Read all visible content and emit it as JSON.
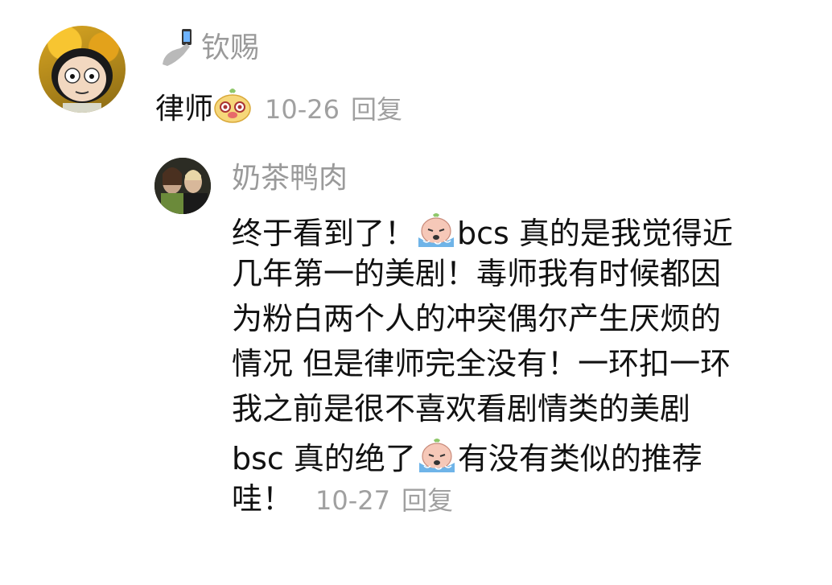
{
  "comment": {
    "username": "钦赐",
    "text": "律师",
    "date": "10-26",
    "reply_label": "回复"
  },
  "reply": {
    "username": "奶茶鸭肉",
    "lines": [
      {
        "before": "终于看到了！",
        "after": "bcs 真的是我觉得近"
      },
      {
        "text": "几年第一的美剧！毒师我有时候都因"
      },
      {
        "text": "为粉白两个人的冲突偶尔产生厌烦的"
      },
      {
        "text": "情况 但是律师完全没有！一环扣一环"
      },
      {
        "text": "我之前是很不喜欢看剧情类的美剧"
      },
      {
        "before": "bsc 真的绝了",
        "after": "有没有类似的推荐"
      },
      {
        "text": "哇！"
      }
    ],
    "date": "10-27",
    "reply_label": "回复"
  },
  "icons": {
    "phone_badge": "phone-hand-icon",
    "comment_emoji": "bear-face-emoji-icon",
    "reply_emoji": "crying-doll-emoji-icon"
  },
  "colors": {
    "meta": "#a0a0a0",
    "username": "#9a9a9a",
    "text": "#111111"
  }
}
